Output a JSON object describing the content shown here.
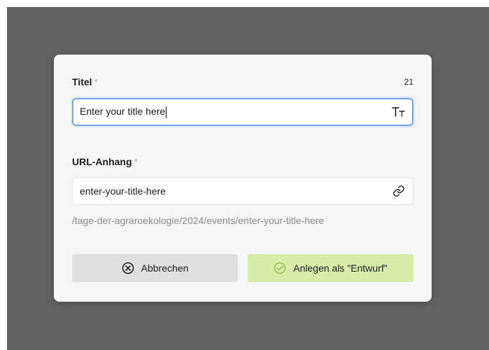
{
  "title_field": {
    "label": "Titel",
    "required_marker": "*",
    "char_count": "21",
    "value": "Enter your title here",
    "icon": "text-size-icon"
  },
  "url_field": {
    "label": "URL-Anhang",
    "required_marker": "*",
    "value": "enter-your-title-here",
    "icon": "link-icon",
    "path_preview": "/tage-der-agraroekologie/2024/events/enter-your-title-here"
  },
  "buttons": {
    "cancel_label": "Abbrechen",
    "cancel_icon": "x-circle-icon",
    "create_label": "Anlegen als \"Entwurf\"",
    "create_icon": "check-circle-icon"
  },
  "colors": {
    "backdrop": "#636363",
    "modal": "#f6f6f6",
    "focus_border": "#7aa7e3",
    "cancel_bg": "#e0e0e0",
    "create_bg": "#d6edab",
    "create_icon": "#8cc04a"
  }
}
